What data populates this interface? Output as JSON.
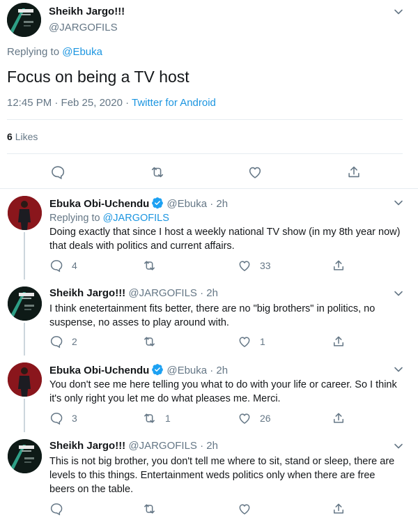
{
  "main_tweet": {
    "name": "Sheikh Jargo!!!",
    "handle": "@JARGOFILS",
    "replying_prefix": "Replying to",
    "replying_to": "@Ebuka",
    "text": "Focus on being a TV host",
    "timestamp": "12:45 PM · Feb 25, 2020 ·",
    "source": "Twitter for Android",
    "likes_count": "6",
    "likes_label": "Likes"
  },
  "replies": [
    {
      "name": "Ebuka Obi-Uchendu",
      "handle": "@Ebuka · 2h",
      "verified": true,
      "replying_prefix": "Replying to",
      "replying_to": "@JARGOFILS",
      "text": "Doing exactly that since I host a weekly national TV show (in my 8th year now) that deals with politics and current affairs.",
      "replies": "4",
      "retweets": "",
      "likes": "33"
    },
    {
      "name": "Sheikh Jargo!!!",
      "handle": "@JARGOFILS · 2h",
      "verified": false,
      "text": "I think enetertainment fits better, there are no \"big brothers\" in politics, no suspense, no asses to play around with.",
      "replies": "2",
      "retweets": "",
      "likes": "1"
    },
    {
      "name": "Ebuka Obi-Uchendu",
      "handle": "@Ebuka · 2h",
      "verified": true,
      "text": "You don't see me here telling you what to do with your life or career. So I think it's only right you let me do what pleases me. Merci.",
      "replies": "3",
      "retweets": "1",
      "likes": "26"
    },
    {
      "name": "Sheikh Jargo!!!",
      "handle": "@JARGOFILS · 2h",
      "verified": false,
      "text": "This is not big brother, you don't tell me where to sit, stand or sleep, there are levels to this things. Entertainment weds politics only when there are free beers on the table.",
      "replies": "",
      "retweets": "",
      "likes": ""
    }
  ],
  "colors": {
    "link": "#1b95e0",
    "secondary_text": "#657786",
    "divider": "#e6ecf0",
    "verified": "#1da1f2"
  }
}
